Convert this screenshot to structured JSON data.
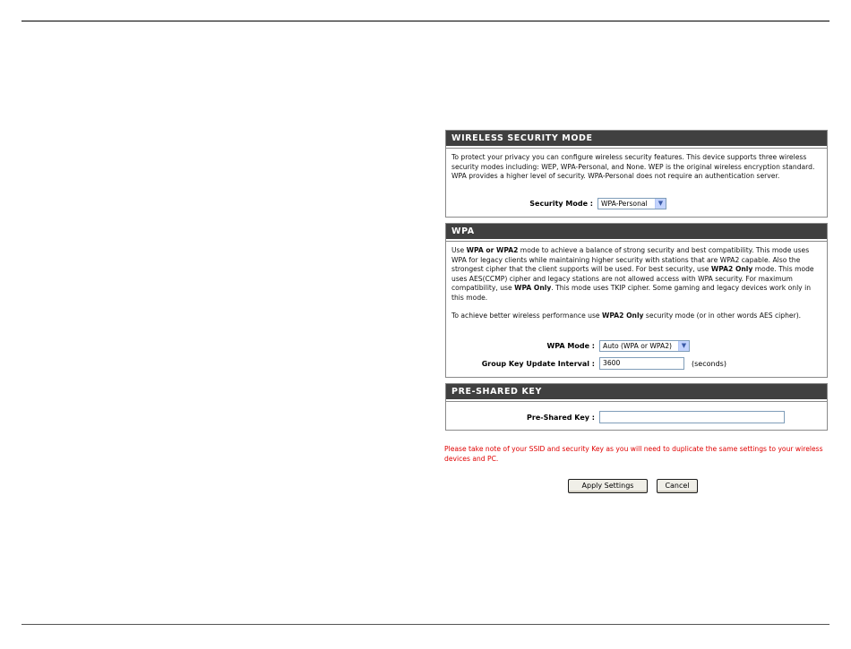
{
  "wireless_security": {
    "header": "WIRELESS SECURITY MODE",
    "description": "To protect your privacy you can configure wireless security features. This device supports three wireless security modes including: WEP, WPA-Personal, and None. WEP is the original wireless encryption standard. WPA provides a higher level of security. WPA-Personal does not require an authentication server.",
    "security_mode_label": "Security Mode :",
    "security_mode_value": "WPA-Personal"
  },
  "wpa": {
    "header": "WPA",
    "desc_1": "Use ",
    "desc_1b": "WPA or WPA2",
    "desc_2": " mode to achieve a balance of strong security and best compatibility. This mode uses WPA for legacy clients while maintaining higher security with stations that are WPA2 capable. Also the strongest cipher that the client supports will be used. For best security, use ",
    "desc_2b": "WPA2 Only",
    "desc_3": " mode. This mode uses AES(CCMP) cipher and legacy stations are not allowed access with WPA security. For maximum compatibility, use ",
    "desc_3b": "WPA Only",
    "desc_4": ". This mode uses TKIP cipher. Some gaming and legacy devices work only in this mode.",
    "perf_1": "To achieve better wireless performance use ",
    "perf_b": "WPA2 Only",
    "perf_2": " security mode (or in other words AES cipher).",
    "wpa_mode_label": "WPA Mode :",
    "wpa_mode_value": "Auto (WPA or WPA2)",
    "group_key_label": "Group Key Update Interval :",
    "group_key_value": "3600",
    "group_key_unit": "(seconds)"
  },
  "psk": {
    "header": "PRE-SHARED KEY",
    "label": "Pre-Shared Key :",
    "value": ""
  },
  "note": "Please take note of your SSID and security Key as you will need to duplicate the same settings to your wireless devices and PC.",
  "buttons": {
    "apply": "Apply Settings",
    "cancel": "Cancel"
  },
  "colors": {
    "header_bg": "#404040",
    "note_text": "#e00000"
  },
  "icons": {
    "dropdown": "chevron-down-icon"
  }
}
